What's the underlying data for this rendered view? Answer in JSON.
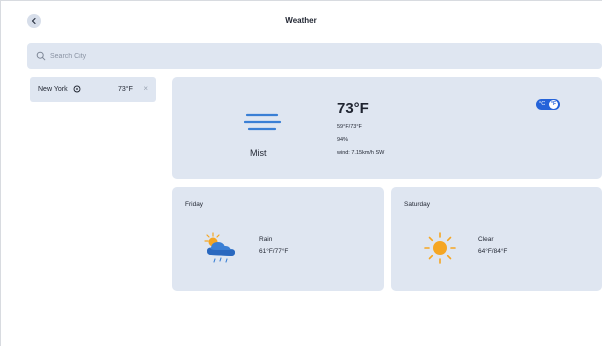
{
  "header": {
    "title": "Weather",
    "back_icon": "chevron-left-icon"
  },
  "search": {
    "placeholder": "Search City",
    "value": "",
    "icon": "search-icon"
  },
  "cities": [
    {
      "name": "New York",
      "temp": "73°F",
      "location_icon": "location-target-icon",
      "close_icon": "close-icon",
      "close_label": "×"
    }
  ],
  "current": {
    "icon": "mist-icon",
    "condition": "Mist",
    "temp": "73°F",
    "range": "59°F/73°F",
    "humidity": "94%",
    "wind": "wind: 7.15km/h SW",
    "unit_toggle": {
      "c_label": "°C",
      "f_label": "°F",
      "selected": "F"
    }
  },
  "forecast": [
    {
      "day": "Friday",
      "icon": "rain-cloud-sun-icon",
      "condition": "Rain",
      "range": "61°F/77°F"
    },
    {
      "day": "Saturday",
      "icon": "sun-icon",
      "condition": "Clear",
      "range": "64°F/84°F"
    }
  ],
  "colors": {
    "card_bg": "#dfe6f1",
    "accent": "#2563d9",
    "mist_icon": "#3a7fd5",
    "sun": "#f5a623"
  }
}
